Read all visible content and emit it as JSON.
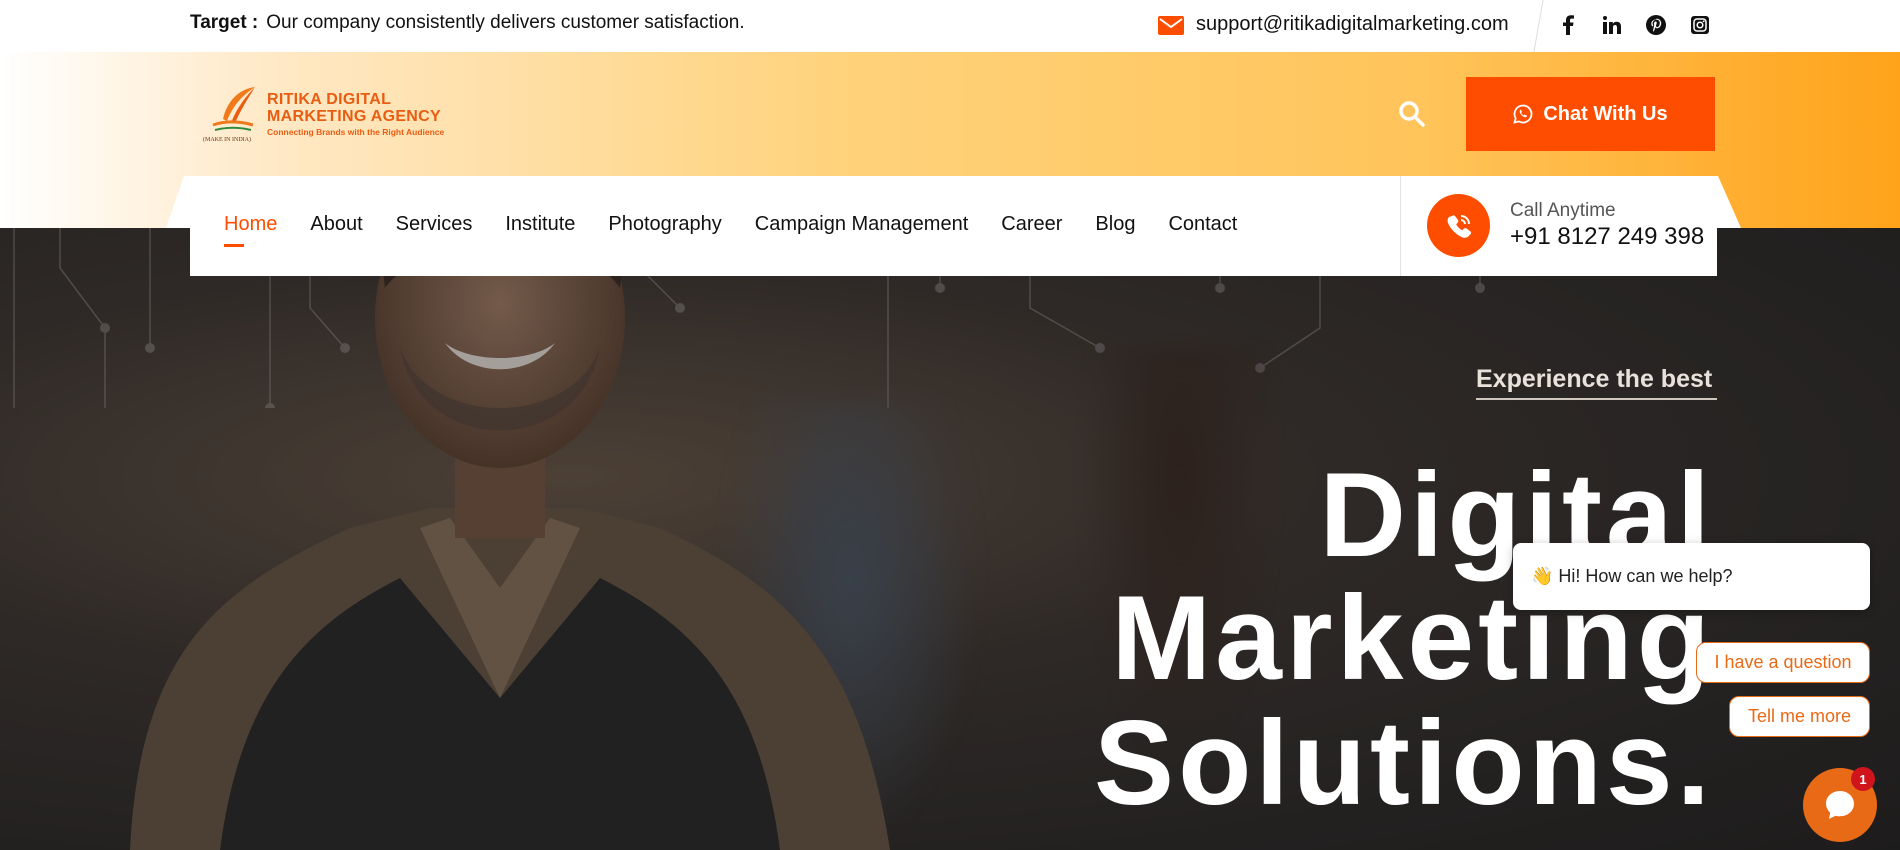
{
  "topbar": {
    "target_label": "Target :",
    "target_text": "Our company consistently delivers customer satisfaction.",
    "email": "support@ritikadigitalmarketing.com",
    "social_icons": [
      "facebook-icon",
      "linkedin-icon",
      "pinterest-icon",
      "instagram-icon"
    ]
  },
  "header": {
    "logo": {
      "line1": "RITIKA DIGITAL",
      "line2": "MARKETING AGENCY",
      "tagline": "Connecting Brands with the Right Audience",
      "badge": "(MAKE IN INDIA)"
    },
    "chat_button": "Chat With Us"
  },
  "nav": {
    "items": [
      {
        "label": "Home",
        "active": true
      },
      {
        "label": "About"
      },
      {
        "label": "Services"
      },
      {
        "label": "Institute"
      },
      {
        "label": "Photography"
      },
      {
        "label": "Campaign Management"
      },
      {
        "label": "Career"
      },
      {
        "label": "Blog"
      },
      {
        "label": "Contact"
      }
    ],
    "call_label": "Call Anytime",
    "call_number": "+91 8127 249 398"
  },
  "hero": {
    "eyebrow": "Experience the best",
    "headline_1": "Digital",
    "headline_2": "Marketing",
    "headline_3": "Solutions."
  },
  "chat_widget": {
    "greeting": "👋 Hi! How can we help?",
    "options": [
      "I have a question",
      "Tell me more"
    ],
    "unread_count": "1"
  },
  "colors": {
    "accent": "#ff4d00",
    "chat_orange": "#e86a16",
    "header_gradient_end": "#ffa31a"
  }
}
